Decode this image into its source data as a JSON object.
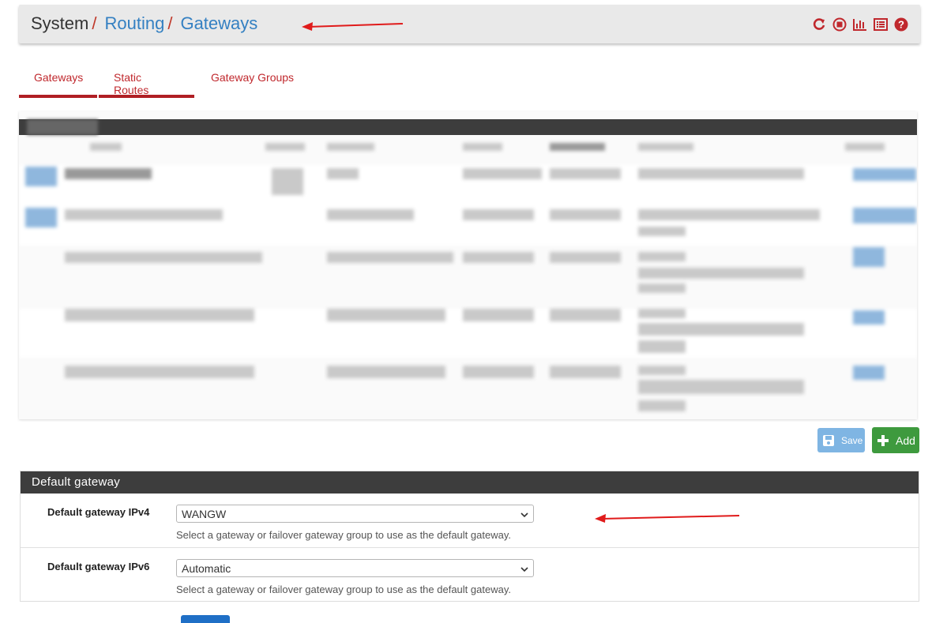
{
  "breadcrumb": {
    "system": "System",
    "routing": "Routing",
    "gateways": "Gateways",
    "separator": "/"
  },
  "header_icons": [
    "reload-icon",
    "stop-icon",
    "chart-icon",
    "list-icon",
    "help-icon"
  ],
  "tabs": [
    {
      "label": "Gateways",
      "active": true
    },
    {
      "label": "Static Routes",
      "active": false
    },
    {
      "label": "Gateway Groups",
      "active": false
    }
  ],
  "actions": {
    "save_label": "Save",
    "add_label": "Add"
  },
  "default_gateway": {
    "title": "Default gateway",
    "ipv4": {
      "label": "Default gateway IPv4",
      "value": "WANGW",
      "help": "Select a gateway or failover gateway group to use as the default gateway."
    },
    "ipv6": {
      "label": "Default gateway IPv6",
      "value": "Automatic",
      "help": "Select a gateway or failover gateway group to use as the default gateway."
    }
  },
  "colors": {
    "accent_red": "#c0282d",
    "link_blue": "#3480c2",
    "save_blue": "#7fb5e3",
    "add_green": "#3e9a3e",
    "panel_header": "#3d3d3d"
  }
}
